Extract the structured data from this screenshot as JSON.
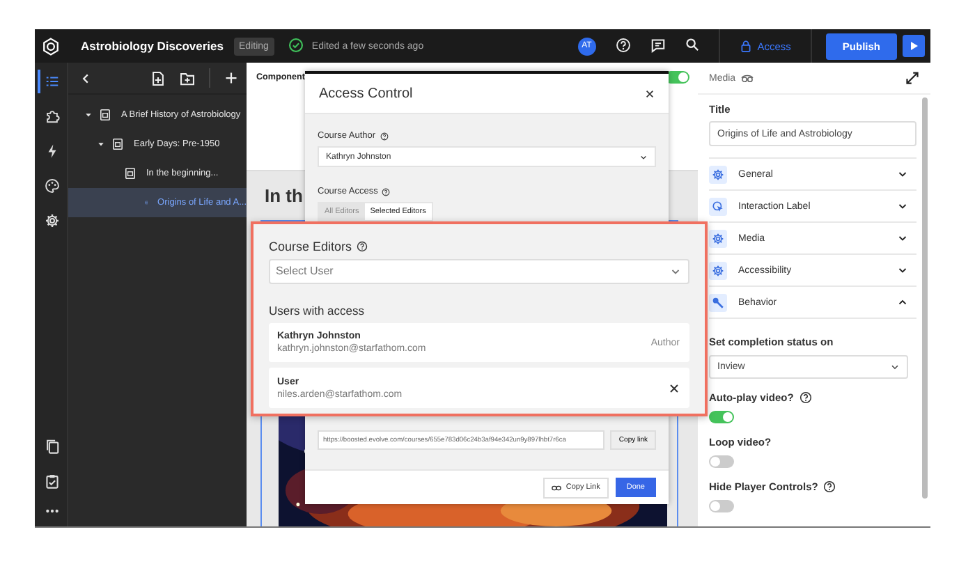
{
  "top_bar": {
    "title": "Astrobiology Discoveries",
    "mode": "Editing",
    "status": "Edited a few seconds ago",
    "avatar": "AT",
    "access": "Access",
    "publish": "Publish"
  },
  "rail": [
    {
      "selected": true
    },
    {
      "selected": false
    },
    {
      "selected": false
    },
    {
      "selected": false
    },
    {
      "selected": false
    }
  ],
  "tree": [
    {
      "label": "A Brief History of Astrobiology",
      "expanded": true,
      "selected": false,
      "children": [
        {
          "label": "Early Days: Pre-1950",
          "expanded": true,
          "selected": false,
          "children": [
            {
              "label": "In the beginning...",
              "selected": false,
              "children": [
                {
                  "label": "Origins of Life and A...",
                  "selected": true
                }
              ]
            }
          ]
        }
      ]
    }
  ],
  "canvas": {
    "header": "Component",
    "toggle_on": true,
    "heading": "In th"
  },
  "dialog": {
    "title": "Access Control",
    "author_label": "Course Author",
    "author": "Kathryn Johnston",
    "access_label": "Course Access",
    "access_tabs": [
      {
        "label": "All Editors",
        "selected": false
      },
      {
        "label": "Selected Editors",
        "selected": true
      }
    ],
    "link": "https://boosted.evolve.com/courses/655e783d06c24b3af94e342un9y897lhbt7r6ca",
    "copy_link_small": "Copy link",
    "copy_link": "Copy Link",
    "done": "Done"
  },
  "editors": {
    "label": "Course Editors",
    "select_placeholder": "Select User",
    "users_heading": "Users with access",
    "users": [
      {
        "name": "Kathryn Johnston",
        "email": "kathryn.johnston@starfathom.com",
        "role": "Author",
        "kind": "author"
      },
      {
        "name": "User",
        "email": "niles.arden@starfathom.com",
        "kind": "removable"
      }
    ]
  },
  "properties": {
    "type": "Media",
    "title_label": "Title",
    "title_value": "Origins of Life and Astrobiology",
    "sections": [
      {
        "label": "General",
        "expanded": false
      },
      {
        "label": "Interaction Label",
        "expanded": false
      },
      {
        "label": "Media",
        "expanded": false
      },
      {
        "label": "Accessibility",
        "expanded": false
      },
      {
        "label": "Behavior",
        "expanded": true
      }
    ],
    "completion_label": "Set completion status on",
    "completion_value": "Inview",
    "toggles": [
      {
        "label": "Auto-play video?",
        "help": true,
        "on": true
      },
      {
        "label": "Loop video?",
        "help": false,
        "on": false
      },
      {
        "label": "Hide Player Controls?",
        "help": true,
        "on": false
      }
    ]
  }
}
